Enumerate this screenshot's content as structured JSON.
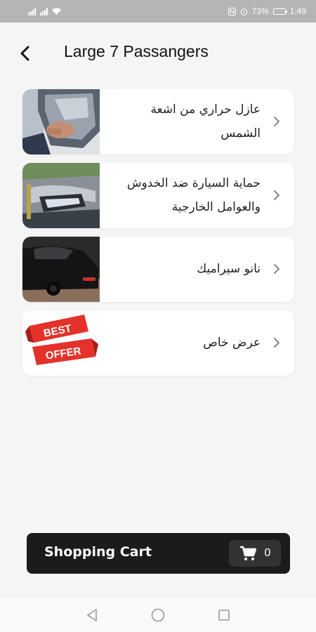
{
  "status_bar": {
    "battery": "73%",
    "time": "1:49"
  },
  "header": {
    "title": "Large 7 Passangers",
    "back_icon": "arrow-left-icon"
  },
  "items": [
    {
      "label": "عازل حراري من اشعة الشمس",
      "image": "window-tint-photo"
    },
    {
      "label": "حماية السيارة ضد الخدوش والعوامل الخارجية",
      "image": "car-headlight-photo"
    },
    {
      "label": "نانو سيراميك",
      "image": "black-car-photo"
    },
    {
      "label": "عرض خاص",
      "image": "best-offer-banner"
    }
  ],
  "offer_banner": {
    "line1": "BEST",
    "line2": "OFFER"
  },
  "cart": {
    "label": "Shopping Cart",
    "count": "0",
    "icon": "shopping-cart-icon"
  },
  "colors": {
    "background": "#f5f5f5",
    "card": "#ffffff",
    "cart_bar": "#1b1b1b",
    "offer_red": "#e4322b"
  }
}
